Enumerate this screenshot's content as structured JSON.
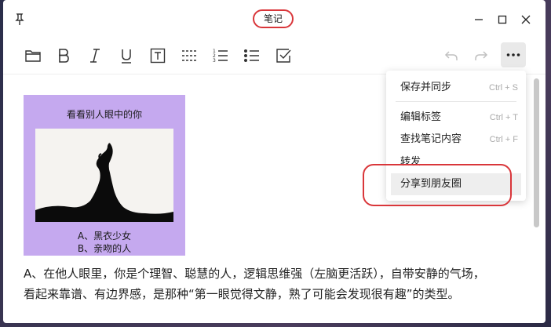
{
  "window": {
    "title": "笔记"
  },
  "toolbar": {
    "icons": [
      "folder-icon",
      "bold-icon",
      "italic-icon",
      "underline-icon",
      "text-box-icon",
      "dashed-line-icon",
      "numbered-list-icon",
      "bullet-list-icon",
      "checkbox-icon",
      "undo-icon",
      "redo-icon",
      "more-icon"
    ]
  },
  "menu": {
    "items": [
      {
        "label": "保存并同步",
        "shortcut": "Ctrl + S"
      },
      {
        "label": "编辑标签",
        "shortcut": "Ctrl + T"
      },
      {
        "label": "查找笔记内容",
        "shortcut": "Ctrl + F"
      },
      {
        "label": "转发",
        "shortcut": ""
      },
      {
        "label": "分享到朋友圈",
        "shortcut": ""
      }
    ]
  },
  "note": {
    "card_title": "看看别人眼中的你",
    "card_option_a": "A、黑衣少女",
    "card_option_b": "B、亲吻的人",
    "paragraph_line1": "A、在他人眼里，你是个理智、聪慧的人，逻辑思维强（左脑更活跃），自带安静的气场，",
    "paragraph_line2": "看起来靠谱、有边界感，是那种“第一眼觉得文静，熟了可能会发现很有趣”的类型。"
  },
  "colors": {
    "card_bg": "#c5a9ef",
    "highlight": "#d9363a",
    "menu_active": "#eeeeee"
  }
}
